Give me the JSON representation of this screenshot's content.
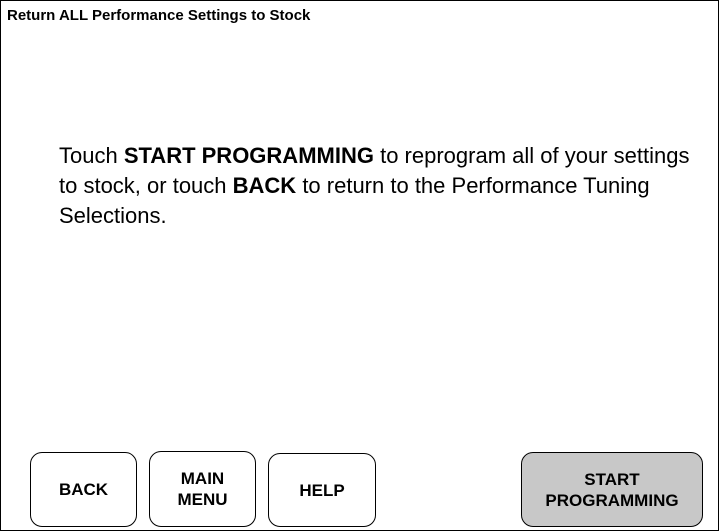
{
  "screen": {
    "title": "Return ALL Performance Settings to Stock"
  },
  "instructions": {
    "part1": "Touch ",
    "bold1": "START PROGRAMMING",
    "part2": " to reprogram all of your settings to stock, or  touch ",
    "bold2": "BACK",
    "part3": " to return to the Performance Tuning Selections."
  },
  "buttons": {
    "back": "BACK",
    "main_menu": "MAIN\nMENU",
    "help": "HELP",
    "start_programming": "START\nPROGRAMMING"
  },
  "colors": {
    "background": "#ffffff",
    "border": "#000000",
    "start_button_fill": "#c8c8c8"
  }
}
